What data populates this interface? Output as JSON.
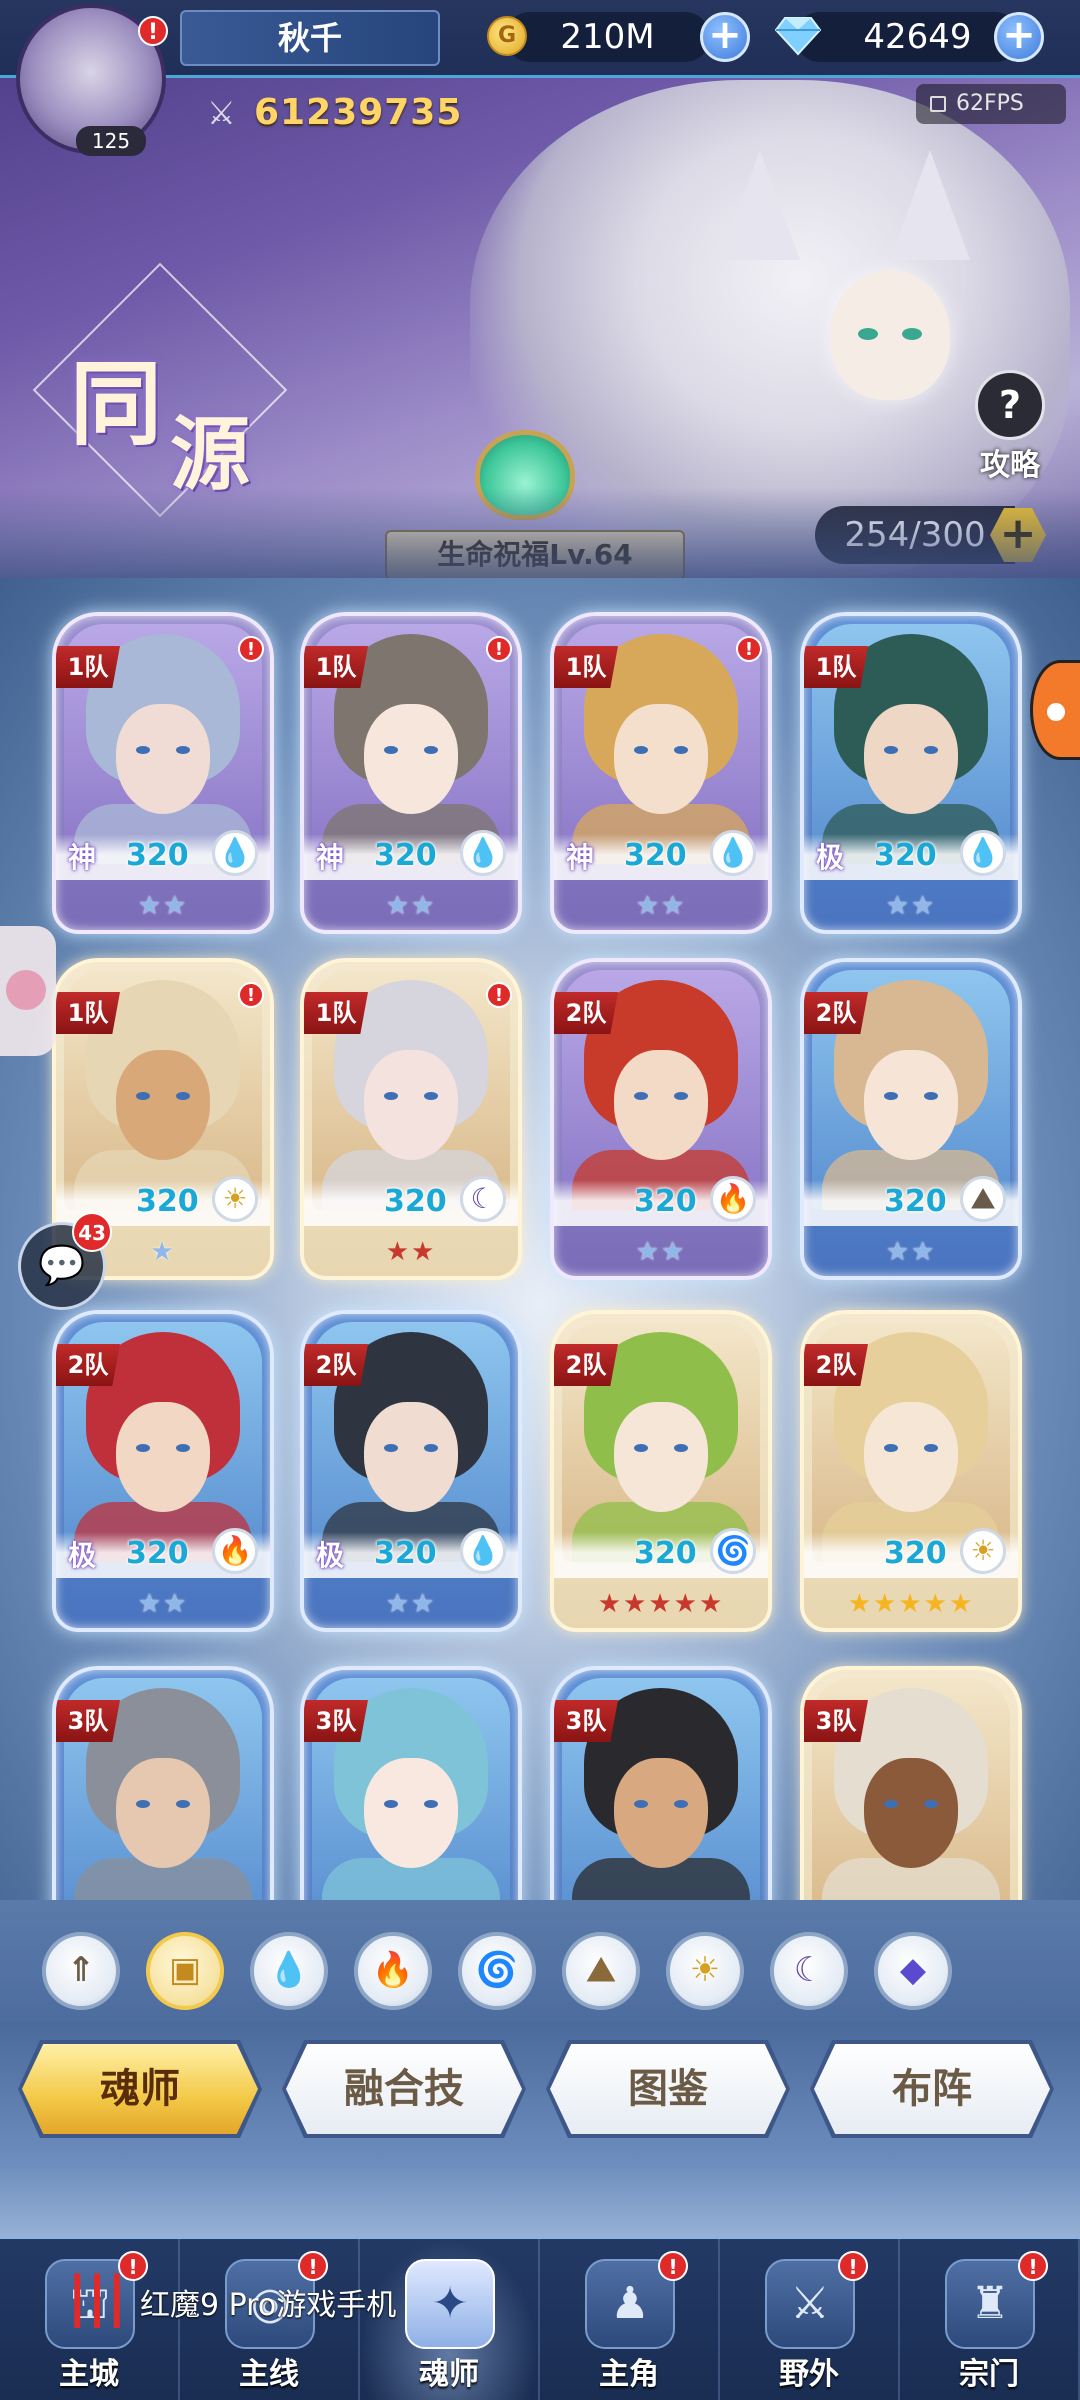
{
  "header": {
    "player_name": "秋千",
    "avatar_level": "125",
    "avatar_alert": "!",
    "gold": "210M",
    "diamonds": "42649",
    "plus": "+",
    "power": "61239735",
    "fps": "62FPS"
  },
  "banner": {
    "mode_char_1": "同",
    "mode_char_2": "源",
    "blessing": "生命祝福Lv.64",
    "guide_icon": "?",
    "guide_label": "攻略",
    "capacity": "254/300",
    "capacity_plus": "+"
  },
  "cards": [
    {
      "team": "1队",
      "rank": "神",
      "level": "320",
      "element": "water",
      "element_glyph": "💧",
      "stars": "★★",
      "star_color": "blue",
      "alert": true,
      "hair": "#a9b8d6",
      "skin": "#f0dcd4",
      "bg": "purple"
    },
    {
      "team": "1队",
      "rank": "神",
      "level": "320",
      "element": "water",
      "element_glyph": "💧",
      "stars": "★★",
      "star_color": "blue",
      "alert": true,
      "hair": "#7d756e",
      "skin": "#f6e6dc",
      "bg": "purple"
    },
    {
      "team": "1队",
      "rank": "神",
      "level": "320",
      "element": "water",
      "element_glyph": "💧",
      "stars": "★★",
      "star_color": "blue",
      "alert": true,
      "hair": "#d8a85a",
      "skin": "#f4dfcc",
      "bg": "purple"
    },
    {
      "team": "1队",
      "rank": "极",
      "level": "320",
      "element": "water",
      "element_glyph": "💧",
      "stars": "★★",
      "star_color": "blue",
      "alert": false,
      "hair": "#2d5b55",
      "skin": "#eed7c4",
      "bg": "blue"
    },
    {
      "team": "1队",
      "rank": "",
      "level": "320",
      "element": "light",
      "element_glyph": "☀",
      "stars": "★",
      "star_color": "blue",
      "alert": true,
      "hair": "#e6d6b4",
      "skin": "#d8a878",
      "bg": "gold"
    },
    {
      "team": "1队",
      "rank": "",
      "level": "320",
      "element": "dark",
      "element_glyph": "☾",
      "stars": "★★",
      "star_color": "red",
      "alert": true,
      "hair": "#d6d4dc",
      "skin": "#f4e2de",
      "bg": "gold"
    },
    {
      "team": "2队",
      "rank": "",
      "level": "320",
      "element": "fire",
      "element_glyph": "🔥",
      "stars": "★★",
      "star_color": "blue",
      "alert": false,
      "hair": "#c83a2a",
      "skin": "#f2dac6",
      "bg": "purple"
    },
    {
      "team": "2队",
      "rank": "",
      "level": "320",
      "element": "earth",
      "element_glyph": "⛰",
      "stars": "★★",
      "star_color": "blue",
      "alert": false,
      "hair": "#d8b892",
      "skin": "#f6e4d6",
      "bg": "blue"
    },
    {
      "team": "2队",
      "rank": "极",
      "level": "320",
      "element": "fire",
      "element_glyph": "🔥",
      "stars": "★★",
      "star_color": "blue",
      "alert": false,
      "hair": "#c0303a",
      "skin": "#f2d8c4",
      "bg": "blue"
    },
    {
      "team": "2队",
      "rank": "极",
      "level": "320",
      "element": "water",
      "element_glyph": "💧",
      "stars": "★★",
      "star_color": "blue",
      "alert": false,
      "hair": "#2e3440",
      "skin": "#f0dcd0",
      "bg": "blue"
    },
    {
      "team": "2队",
      "rank": "",
      "level": "320",
      "element": "wind",
      "element_glyph": "🌀",
      "stars": "★★★★★",
      "star_color": "red",
      "alert": false,
      "hair": "#8fbf4a",
      "skin": "#f6e6d8",
      "bg": "gold"
    },
    {
      "team": "2队",
      "rank": "",
      "level": "320",
      "element": "light",
      "element_glyph": "☀",
      "stars": "★★★★★",
      "star_color": "gold",
      "alert": false,
      "hair": "#e6cf9a",
      "skin": "#f6e6d6",
      "bg": "gold"
    },
    {
      "team": "3队",
      "rank": "",
      "level": "",
      "element": "",
      "element_glyph": "",
      "stars": "",
      "star_color": "blue",
      "alert": false,
      "hair": "#8a8f9a",
      "skin": "#e6c8b0",
      "bg": "blue"
    },
    {
      "team": "3队",
      "rank": "",
      "level": "",
      "element": "",
      "element_glyph": "",
      "stars": "",
      "star_color": "blue",
      "alert": false,
      "hair": "#7fc3d8",
      "skin": "#f8e8e0",
      "bg": "blue"
    },
    {
      "team": "3队",
      "rank": "",
      "level": "",
      "element": "",
      "element_glyph": "",
      "stars": "",
      "star_color": "blue",
      "alert": false,
      "hair": "#2a2a2e",
      "skin": "#d8a880",
      "bg": "blue"
    },
    {
      "team": "3队",
      "rank": "",
      "level": "",
      "element": "",
      "element_glyph": "",
      "stars": "",
      "star_color": "blue",
      "alert": false,
      "hair": "#e4ddd0",
      "skin": "#8a5a3a",
      "bg": "gold"
    }
  ],
  "side": {
    "chat_icon": "💬",
    "chat_count": "43"
  },
  "filters": [
    {
      "name": "filter-all-icon",
      "glyph": "⇑",
      "color": "#6b5a45",
      "active": false
    },
    {
      "name": "filter-box-icon",
      "glyph": "▣",
      "color": "#c48a1e",
      "active": true
    },
    {
      "name": "filter-water-icon",
      "glyph": "💧",
      "color": "#2a7fd0",
      "active": false
    },
    {
      "name": "filter-fire-icon",
      "glyph": "🔥",
      "color": "#d83a2a",
      "active": false
    },
    {
      "name": "filter-wind-icon",
      "glyph": "🌀",
      "color": "#2aa45a",
      "active": false
    },
    {
      "name": "filter-earth-icon",
      "glyph": "⛰",
      "color": "#8a6a3a",
      "active": false
    },
    {
      "name": "filter-light-icon",
      "glyph": "☀",
      "color": "#d8a020",
      "active": false
    },
    {
      "name": "filter-dark-icon",
      "glyph": "☾",
      "color": "#6a4aa8",
      "active": false
    },
    {
      "name": "filter-special-icon",
      "glyph": "◆",
      "color": "#5a4ad0",
      "active": false
    }
  ],
  "actions": [
    {
      "label": "魂师",
      "active": true
    },
    {
      "label": "融合技",
      "active": false
    },
    {
      "label": "图鉴",
      "active": false
    },
    {
      "label": "布阵",
      "active": false
    }
  ],
  "nav": [
    {
      "label": "主城",
      "icon": "⛫",
      "alert": true,
      "active": false
    },
    {
      "label": "主线",
      "icon": "◎",
      "alert": true,
      "active": false
    },
    {
      "label": "魂师",
      "icon": "✦",
      "alert": false,
      "active": true
    },
    {
      "label": "主角",
      "icon": "♟",
      "alert": true,
      "active": false
    },
    {
      "label": "野外",
      "icon": "⚔",
      "alert": true,
      "active": false
    },
    {
      "label": "宗门",
      "icon": "♜",
      "alert": true,
      "active": false
    }
  ],
  "watermark": {
    "logo": "|||",
    "text": "红魔9 Pro游戏手机"
  }
}
